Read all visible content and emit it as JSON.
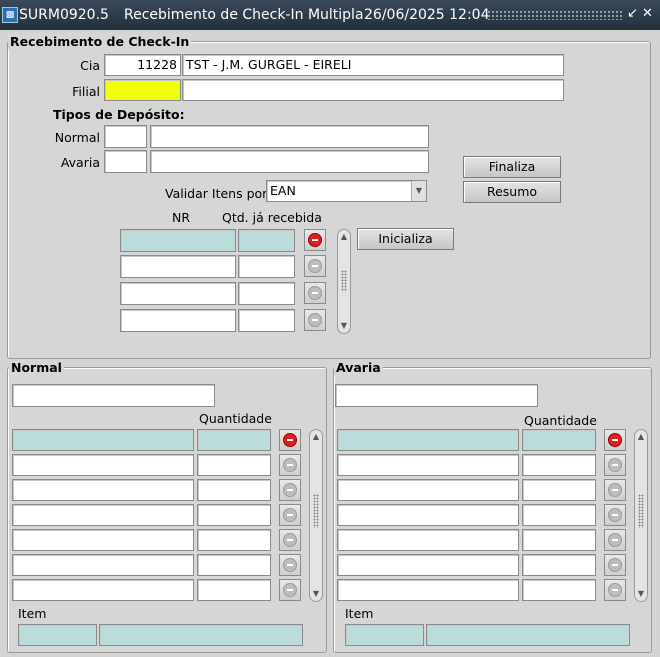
{
  "window": {
    "app_id": "SURM0920.5",
    "title": "Recebimento de Check-In Multipla",
    "datetime": "26/06/2025 12:04",
    "min_icon": "minimize-icon",
    "close_icon": "close-icon"
  },
  "checkin": {
    "frame_label": "Recebimento de Check-In",
    "cia_label": "Cia",
    "cia_code": "11228",
    "cia_name": "TST - J.M. GURGEL - EIRELI",
    "filial_label": "Filial",
    "filial_code": "",
    "filial_name": "",
    "tipos_label": "Tipos de Depósito:",
    "normal_label": "Normal",
    "normal_code": "",
    "normal_name": "",
    "avaria_label": "Avaria",
    "avaria_code": "",
    "avaria_name": "",
    "validar_label": "Validar Itens por:",
    "validar_value": "EAN",
    "finaliza_label": "Finaliza",
    "resumo_label": "Resumo",
    "inicializa_label": "Inicializa",
    "nr_header": "NR",
    "qtd_header": "Qtd. já recebida",
    "rows": [
      {
        "nr": "",
        "qtd": ""
      },
      {
        "nr": "",
        "qtd": ""
      },
      {
        "nr": "",
        "qtd": ""
      },
      {
        "nr": "",
        "qtd": ""
      }
    ]
  },
  "normal_panel": {
    "frame_label": "Normal",
    "top_field": "",
    "quantidade_header": "Quantidade",
    "item_label": "Item",
    "rows": [
      "",
      "",
      "",
      "",
      "",
      "",
      ""
    ]
  },
  "avaria_panel": {
    "frame_label": "Avaria",
    "top_field": "",
    "quantidade_header": "Quantidade",
    "item_label": "Item",
    "rows": [
      "",
      "",
      "",
      "",
      "",
      "",
      ""
    ]
  },
  "colors": {
    "highlight_field": "#f2ff0a",
    "current_row": "#bcdcdc",
    "remove_active": "#e02020"
  }
}
